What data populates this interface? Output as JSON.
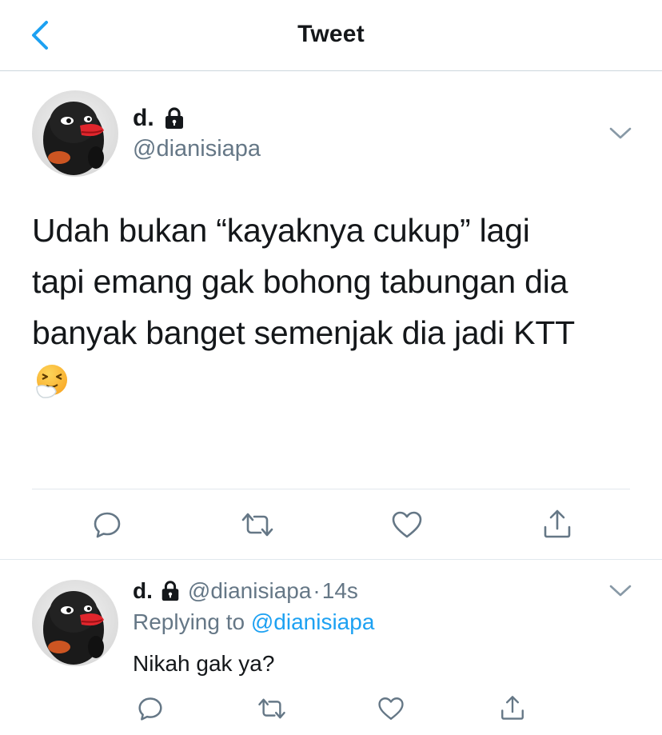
{
  "header": {
    "title": "Tweet"
  },
  "main_tweet": {
    "display_name": "d.",
    "handle": "@dianisiapa",
    "text": "Udah bukan “kayaknya cukup” lagi\ntapi emang gak bohong tabungan dia\nbanyak banget semenjak dia jadi KTT",
    "emoji": "sneezing-face",
    "avatar": "penguin-avatar"
  },
  "reply": {
    "display_name": "d.",
    "handle": "@dianisiapa",
    "separator": "·",
    "time": "14s",
    "replying_label": "Replying to",
    "replying_handle": "@dianisiapa",
    "text": "Nikah gak ya?"
  },
  "icons": {
    "back": "chevron-left-icon",
    "lock": "lock-icon",
    "caret": "chevron-down-icon",
    "reply": "reply-icon",
    "retweet": "retweet-icon",
    "like": "heart-icon",
    "share": "share-icon"
  },
  "colors": {
    "accent": "#1da1f2",
    "text_primary": "#14171a",
    "text_secondary": "#657786",
    "icon_gray": "#657786",
    "divider": "#e1e8ed"
  }
}
